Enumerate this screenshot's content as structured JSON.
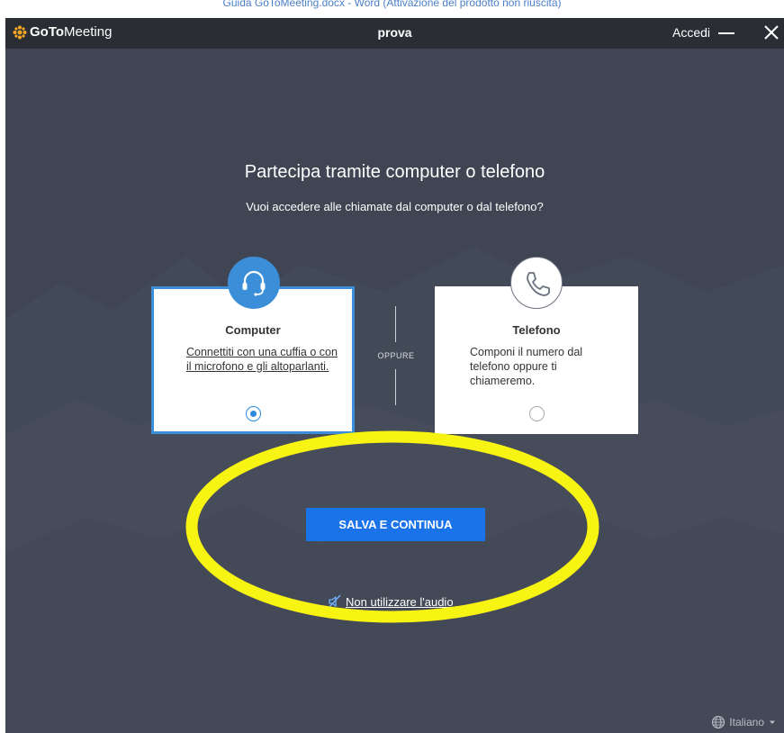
{
  "os_window_title": "Guida GoToMeeting.docx - Word (Attivazione del prodotto non riuscita)",
  "app": {
    "brand_goto": "GoTo",
    "brand_meeting": "Meeting",
    "title": "prova",
    "signin": "Accedi"
  },
  "main": {
    "heading": "Partecipa tramite computer o telefono",
    "subheading": "Vuoi accedere alle chiamate dal computer o dal telefono?",
    "separator": "OPPURE",
    "options": [
      {
        "title": "Computer",
        "description": "Connettiti con una cuffia o con il microfono e gli altoparlanti.",
        "icon": "headset-icon",
        "selected": true
      },
      {
        "title": "Telefono",
        "description": "Componi il numero dal telefono oppure ti chiameremo.",
        "icon": "phone-icon",
        "selected": false
      }
    ],
    "save_button": "SALVA E CONTINUA",
    "no_audio_link": "Non utilizzare l'audio"
  },
  "footer": {
    "language": "Italiano"
  },
  "colors": {
    "background": "#3f4553",
    "titlebar": "#2a2d33",
    "accent": "#1a73e8",
    "selected_border": "#3a8fd8",
    "brand_orange": "#f5a623",
    "highlight": "#f7f312"
  }
}
